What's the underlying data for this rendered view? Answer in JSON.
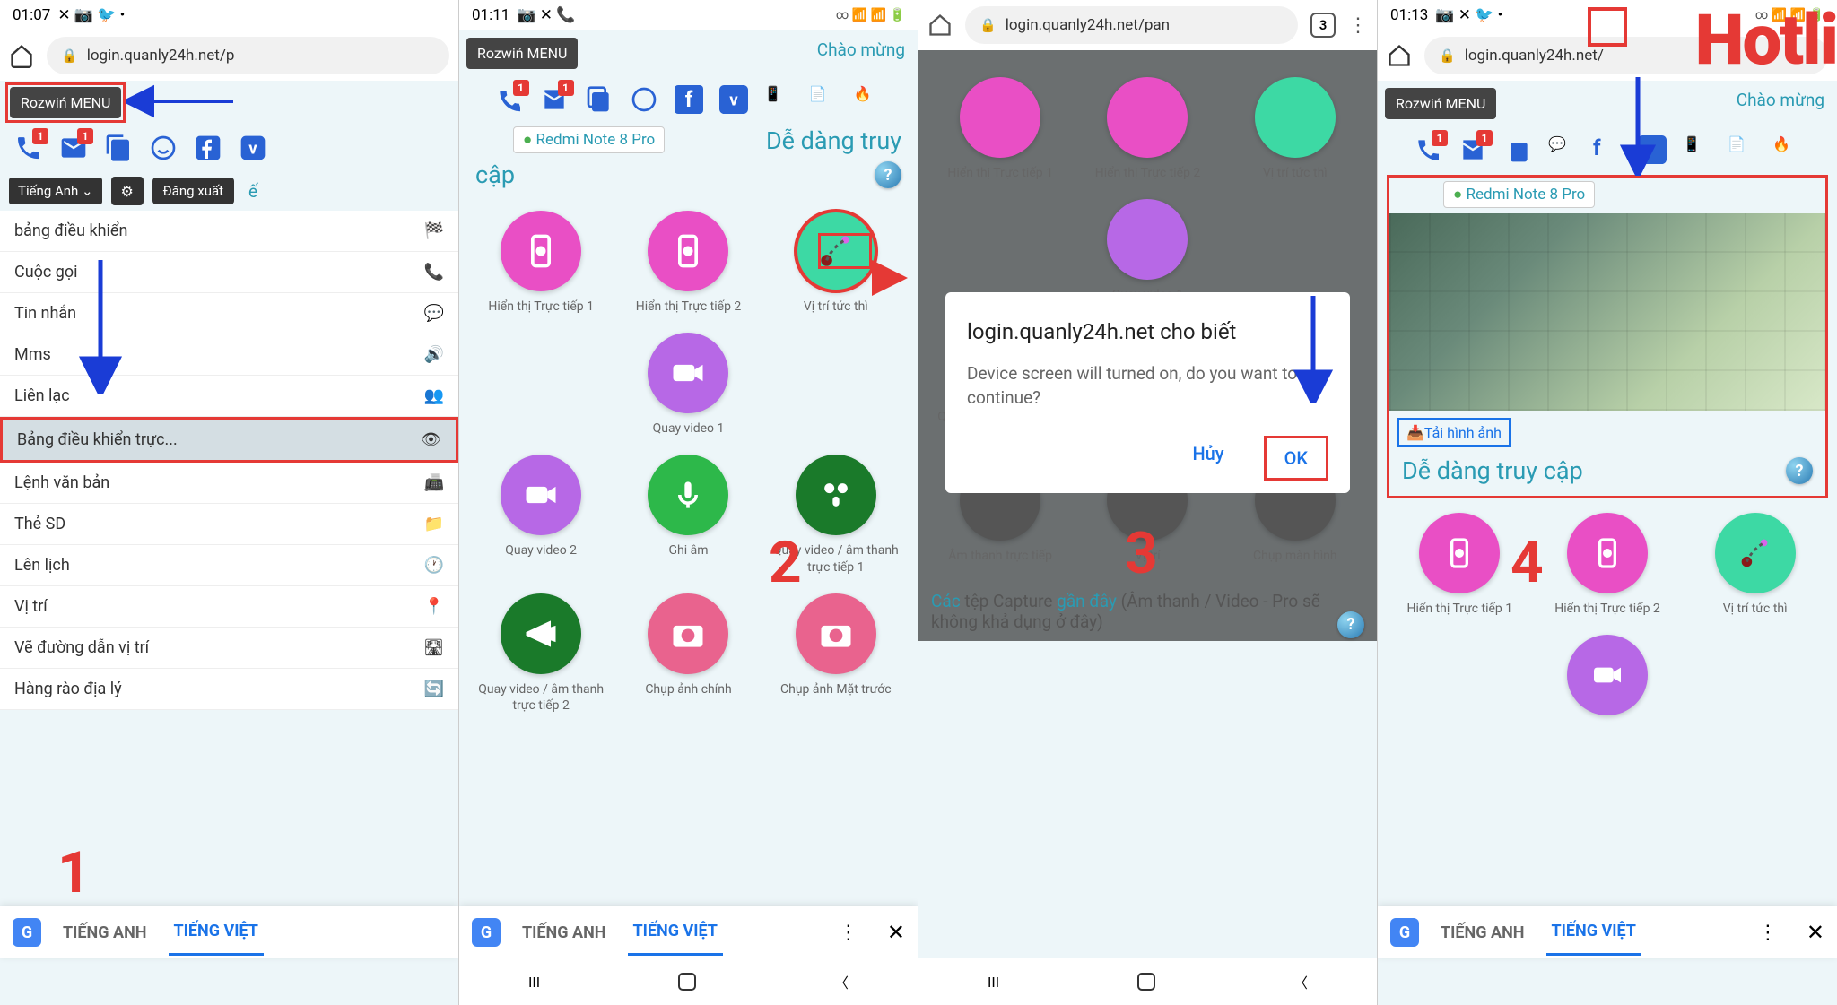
{
  "status": {
    "t1": "01:07",
    "t2": "01:11",
    "t4": "01:13"
  },
  "url": "login.quanly24h.net/p",
  "url_full": "login.quanly24h.net/pan",
  "menu_btn": "Rozwiń MENU",
  "welcome": "Chào mừng",
  "lang": "Tiếng Anh",
  "logout": "Đăng xuất",
  "menu_e": "ế",
  "menu": [
    {
      "l": "bảng điều khiển",
      "i": "dashboard"
    },
    {
      "l": "Cuộc gọi",
      "i": "phone"
    },
    {
      "l": "Tin nhắn",
      "i": "chat"
    },
    {
      "l": "Mms",
      "i": "sound"
    },
    {
      "l": "Liên lạc",
      "i": "people"
    },
    {
      "l": "Bảng điều khiển trực...",
      "i": "eye",
      "sel": true
    },
    {
      "l": "Lệnh văn bản",
      "i": "fax"
    },
    {
      "l": "Thẻ SD",
      "i": "folder"
    },
    {
      "l": "Lên lịch",
      "i": "clock"
    },
    {
      "l": "Vị trí",
      "i": "pin"
    },
    {
      "l": "Vẽ đường dẫn vị trí",
      "i": "road"
    },
    {
      "l": "Hàng rào địa lý",
      "i": "refresh"
    }
  ],
  "device": "Redmi Note 8 Pro",
  "dedang": "Dễ dàng truy cập",
  "apps": [
    {
      "l": "Hiển thị Trực tiếp 1",
      "c": "#e94fc5",
      "i": "play-phone"
    },
    {
      "l": "Hiển thị Trực tiếp 2",
      "c": "#e94fc5",
      "i": "play-phone"
    },
    {
      "l": "Vị trí tức thì",
      "c": "#3dd9a4",
      "i": "route"
    },
    {
      "l": "Quay video 1",
      "c": "#b768e6",
      "i": "video"
    },
    {
      "l": "Quay video 2",
      "c": "#b768e6",
      "i": "video"
    },
    {
      "l": "Ghi âm",
      "c": "#2db84a",
      "i": "mic"
    },
    {
      "l": "Quay video / âm thanh trực tiếp 1",
      "c": "#1a7a2a",
      "i": "mic-people"
    },
    {
      "l": "Quay video / âm thanh trực tiếp 2",
      "c": "#1a7a2a",
      "i": "announce"
    },
    {
      "l": "Chụp ảnh chính",
      "c": "#e9638e",
      "i": "camera"
    },
    {
      "l": "Chụp ảnh Mặt trước",
      "c": "#e9638e",
      "i": "camera"
    }
  ],
  "apps3": [
    {
      "l": "Hiển thị Trực tiếp 1",
      "c": "#e94fc5"
    },
    {
      "l": "Hiển thị Trực tiếp 2",
      "c": "#e94fc5"
    },
    {
      "l": "Vị trí tức thì",
      "c": "#3dd9a4"
    },
    {
      "l": "Quay video 1",
      "c": "#b768e6"
    },
    {
      "l": "Quay video / âm thanh trực tiếp 2",
      "c": "#1a7a2a"
    },
    {
      "l": "Chụp ảnh chính",
      "c": "#e9638e"
    },
    {
      "l": "Chụp ảnh Mặt trước",
      "c": "#e9638e"
    },
    {
      "l": "Âm thanh trực tiếp",
      "c": "#555"
    },
    {
      "l": "Vị trí",
      "c": "#555"
    },
    {
      "l": "Chụp màn hình",
      "c": "#555"
    }
  ],
  "dialog": {
    "title": "login.quanly24h.net cho biết",
    "msg": "Device screen will turned on, do you want to continue?",
    "cancel": "Hủy",
    "ok": "OK"
  },
  "recent": "Các tệp Capture gần đây (Âm thanh / Video - Pro sẽ không khả dụng ở đây)",
  "download": "Tải hình ảnh",
  "trans": {
    "en": "TIẾNG ANH",
    "vi": "TIẾNG VIỆT"
  },
  "tab_count": "3",
  "badge": "1",
  "nums": {
    "n1": "1",
    "n2": "2",
    "n3": "3",
    "n4": "4"
  },
  "hotli": "Hotli"
}
